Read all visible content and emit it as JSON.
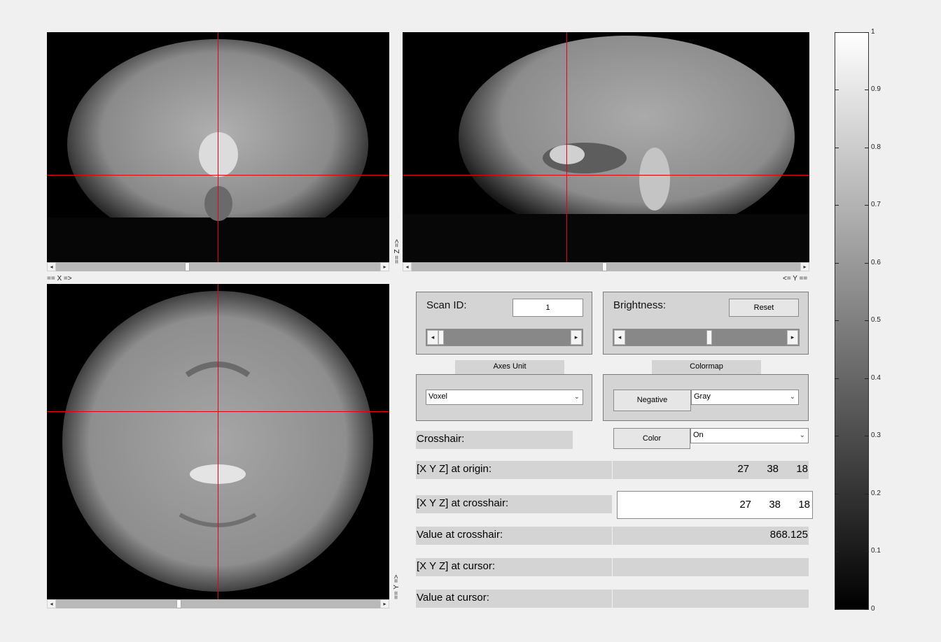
{
  "views": {
    "coronal": {
      "x_axis_label": "== X =>"
    },
    "sagittal": {
      "y_axis_label": "<= Y ==",
      "z_axis_label": "== Z =>"
    },
    "axial": {
      "y_axis_label": "== Y =>"
    }
  },
  "scan": {
    "label": "Scan ID:",
    "value": "1"
  },
  "brightness": {
    "label": "Brightness:",
    "reset_label": "Reset",
    "level": 0.5
  },
  "axes_unit": {
    "tab": "Axes Unit",
    "selected": "Voxel"
  },
  "colormap": {
    "tab": "Colormap",
    "negative_label": "Negative",
    "selected": "Gray"
  },
  "crosshair": {
    "label": "Crosshair:",
    "color_label": "Color",
    "selected": "On",
    "color": "#e8000b"
  },
  "info": {
    "origin_label": "[X Y Z] at origin:",
    "origin": [
      "27",
      "38",
      "18"
    ],
    "crosshair_label": "[X Y Z] at crosshair:",
    "crosshair_xyz": [
      "27",
      "38",
      "18"
    ],
    "value_crosshair_label": "Value at crosshair:",
    "value_crosshair": "868.125",
    "cursor_label": "[X Y Z] at cursor:",
    "value_cursor_label": "Value at cursor:"
  },
  "colorbar": {
    "ticks": [
      "0",
      "0.1",
      "0.2",
      "0.3",
      "0.4",
      "0.5",
      "0.6",
      "0.7",
      "0.8",
      "0.9",
      "1"
    ]
  }
}
